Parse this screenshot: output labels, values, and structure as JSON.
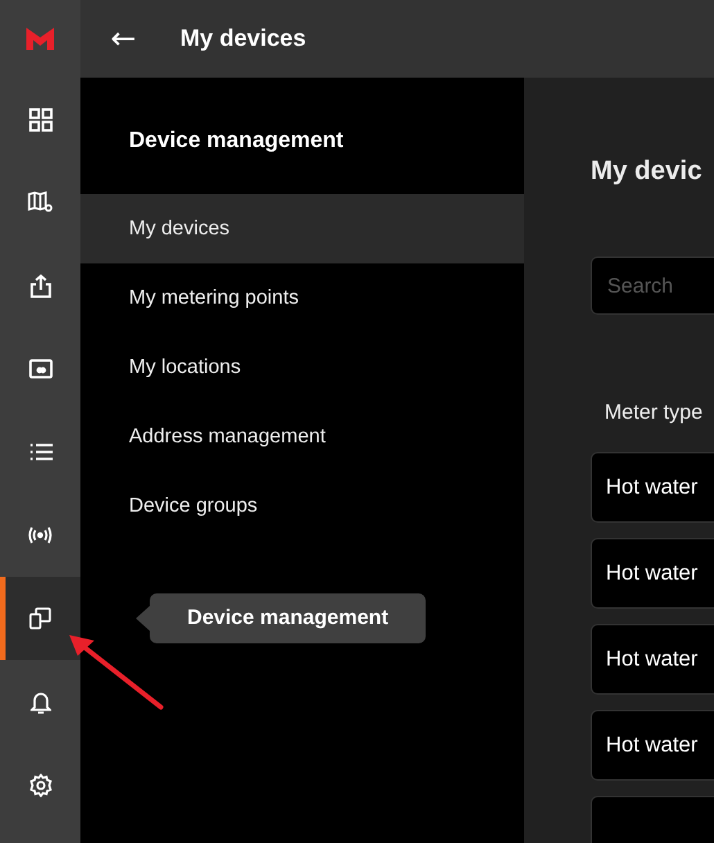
{
  "rail": [
    {
      "kind": "logo",
      "selected": false
    },
    {
      "kind": "dashboard",
      "selected": false
    },
    {
      "kind": "map",
      "selected": false
    },
    {
      "kind": "upload",
      "selected": false
    },
    {
      "kind": "card",
      "selected": false
    },
    {
      "kind": "list",
      "selected": false
    },
    {
      "kind": "signal",
      "selected": false
    },
    {
      "kind": "devices",
      "selected": true
    },
    {
      "kind": "bell",
      "selected": false
    },
    {
      "kind": "settings",
      "selected": false
    }
  ],
  "topbar": {
    "back": "←",
    "title": "My devices"
  },
  "panel": {
    "title": "Device management",
    "items": [
      {
        "label": "My devices",
        "selected": true
      },
      {
        "label": "My metering points",
        "selected": false
      },
      {
        "label": "My locations",
        "selected": false
      },
      {
        "label": "Address management",
        "selected": false
      },
      {
        "label": "Device groups",
        "selected": false
      }
    ]
  },
  "tooltip": "Device management",
  "main": {
    "title": "My devic",
    "search": {
      "placeholder": "Search"
    },
    "column": "Meter type",
    "rows": [
      "Hot water",
      "Hot water",
      "Hot water",
      "Hot water",
      ""
    ]
  }
}
